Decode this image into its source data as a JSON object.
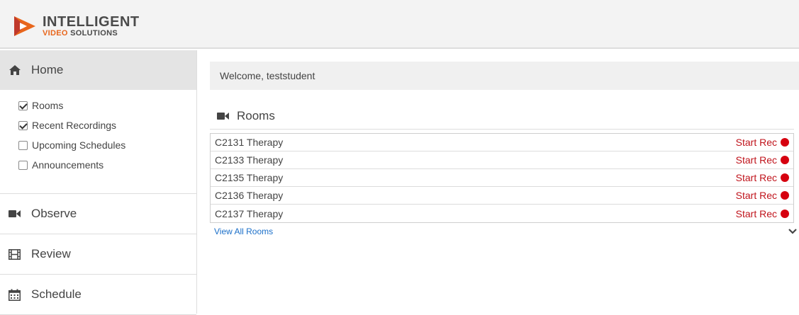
{
  "header": {
    "logo_line1": "INTELLIGENT",
    "logo_line2_accent": "VIDEO",
    "logo_line2_rest": " SOLUTIONS"
  },
  "sidebar": {
    "home_label": "Home",
    "checklist": [
      {
        "label": "Rooms",
        "checked": true
      },
      {
        "label": "Recent Recordings",
        "checked": true
      },
      {
        "label": "Upcoming Schedules",
        "checked": false
      },
      {
        "label": "Announcements",
        "checked": false
      }
    ],
    "nav": [
      {
        "label": "Observe",
        "icon": "video-camera-icon"
      },
      {
        "label": "Review",
        "icon": "film-icon"
      },
      {
        "label": "Schedule",
        "icon": "calendar-icon"
      }
    ]
  },
  "main": {
    "welcome": "Welcome, teststudent",
    "rooms_title": "Rooms",
    "rooms": [
      {
        "name": "C2131 Therapy",
        "action": "Start Rec"
      },
      {
        "name": "C2133 Therapy",
        "action": "Start Rec"
      },
      {
        "name": "C2135 Therapy",
        "action": "Start Rec"
      },
      {
        "name": "C2136 Therapy",
        "action": "Start Rec"
      },
      {
        "name": "C2137 Therapy",
        "action": "Start Rec"
      }
    ],
    "view_all": "View All Rooms"
  },
  "colors": {
    "accent": "#e8661c",
    "record_red": "#d6000f",
    "link_blue": "#1a6fc9"
  }
}
